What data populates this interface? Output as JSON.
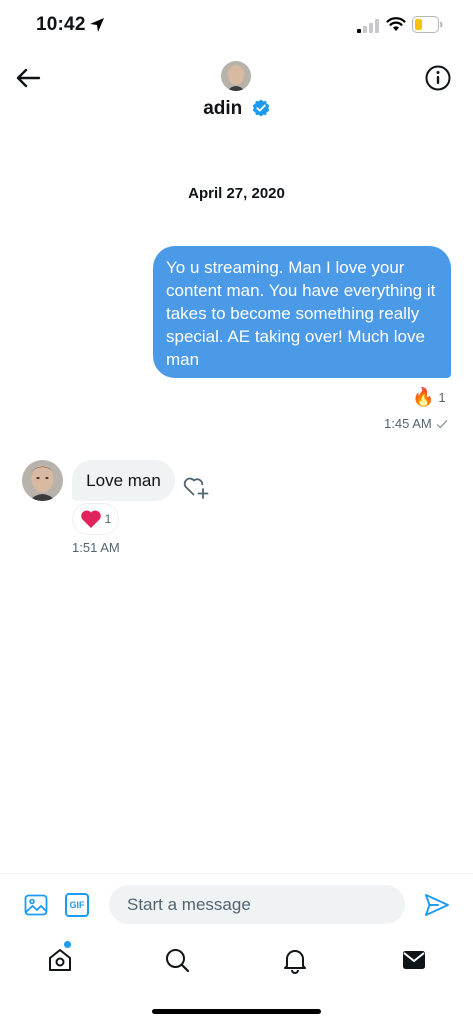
{
  "status_bar": {
    "time": "10:42"
  },
  "header": {
    "name": "adin",
    "verified": true
  },
  "conversation": {
    "date": "April 27, 2020",
    "messages": [
      {
        "direction": "outgoing",
        "text": "Yo u streaming. Man I love your content man. You have everything it takes to become something really special. AE taking over! Much love man",
        "reaction": {
          "emoji": "🔥",
          "count": "1"
        },
        "time": "1:45 AM"
      },
      {
        "direction": "incoming",
        "text": "Love man",
        "reaction": {
          "emoji": "heart",
          "count": "1"
        },
        "time": "1:51 AM"
      }
    ]
  },
  "composer": {
    "gif_label": "GIF",
    "placeholder": "Start a message"
  },
  "colors": {
    "accent": "#1d9bf0",
    "bubble_outgoing": "#4a9ae8",
    "bubble_incoming": "#eff3f4",
    "heart": "#e0245e"
  },
  "tabs": [
    "home-icon",
    "search-icon",
    "bell-icon",
    "mail-icon"
  ]
}
